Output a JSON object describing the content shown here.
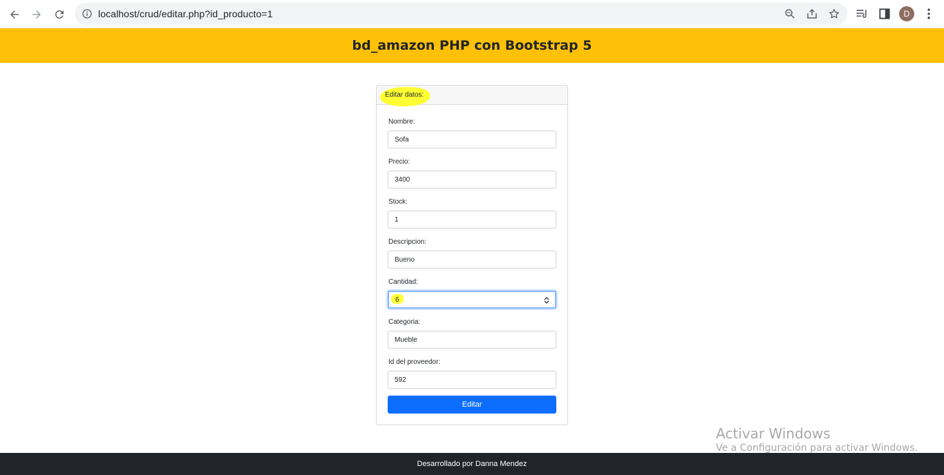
{
  "browser": {
    "url": "localhost/crud/editar.php?id_producto=1",
    "avatar_letter": "D",
    "icons": [
      "back-icon",
      "forward-icon",
      "reload-icon",
      "info-icon",
      "zoom-icon",
      "share-icon",
      "star-icon",
      "media-icon",
      "sidepanel-icon",
      "menu-icon"
    ]
  },
  "header": {
    "title": "bd_amazon PHP con Bootstrap 5"
  },
  "card": {
    "title": "Editar datos:",
    "fields": [
      {
        "label": "Nombre:",
        "value": "Sofa"
      },
      {
        "label": "Precio:",
        "value": "3400"
      },
      {
        "label": "Stock:",
        "value": "1"
      },
      {
        "label": "Descripcion:",
        "value": "Bueno"
      },
      {
        "label": "Cantidad:",
        "value": "6"
      },
      {
        "label": "Categoria:",
        "value": "Mueble"
      },
      {
        "label": "Id del proveedor:",
        "value": "592"
      }
    ],
    "submit_label": "Editar"
  },
  "watermark": {
    "title": "Activar Windows",
    "subtitle": "Ve a Configuración para activar Windows."
  },
  "footer": {
    "text": "Desarrollado por Danna Mendez"
  },
  "colors": {
    "header_bg": "#ffc107",
    "button_bg": "#0d6efd",
    "footer_bg": "#212529",
    "highlight": "#ffff33"
  }
}
